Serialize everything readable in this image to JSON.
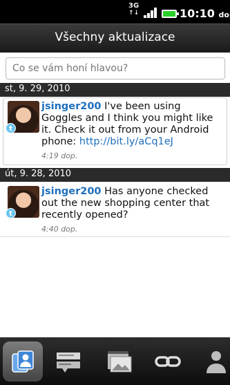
{
  "status_bar": {
    "network": "3G",
    "time": "10:10",
    "ampm": "dop."
  },
  "header": {
    "title": "Všechny aktualizace"
  },
  "search": {
    "placeholder": "Co se vám honí hlavou?"
  },
  "groups": [
    {
      "date": "st, 9. 29, 2010",
      "tweet": {
        "user": "jsinger200",
        "text": "I've been using Goggles and I think you might like it. Check it out from your Android phone:",
        "link": "http://bit.ly/aCq1eJ",
        "time": "4:19 dop."
      }
    },
    {
      "date": "út, 9. 28, 2010",
      "tweet": {
        "user": "jsinger200",
        "text": "Has anyone checked out the new shopping center that recently opened?",
        "time": "4:40 dop."
      }
    }
  ],
  "tabs": [
    {
      "icon": "people-icon",
      "active": true
    },
    {
      "icon": "messages-icon",
      "active": false
    },
    {
      "icon": "photos-icon",
      "active": false
    },
    {
      "icon": "link-icon",
      "active": false
    },
    {
      "icon": "person-icon",
      "active": false
    }
  ],
  "colors": {
    "link": "#1f6fbd",
    "twitter": "#6cc4ef"
  }
}
